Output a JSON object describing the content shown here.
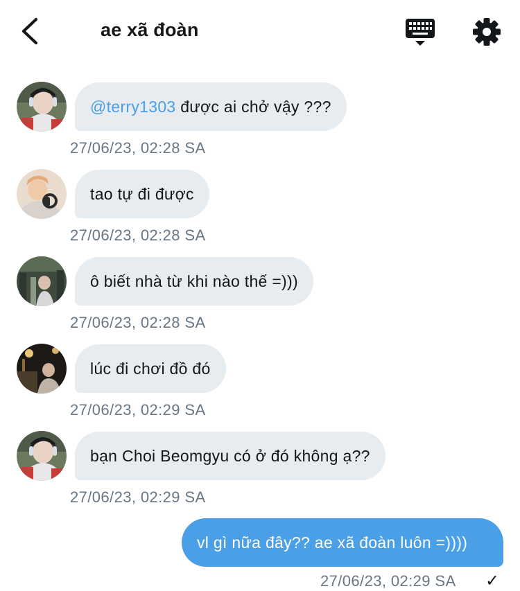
{
  "header": {
    "title": "ae xã đoàn",
    "back_icon": "chevron-left-icon",
    "keyboard_icon": "keyboard-icon",
    "settings_icon": "gear-icon"
  },
  "colors": {
    "incoming_bubble": "#e6ecf0",
    "outgoing_bubble": "#4a9fe6",
    "mention": "#4a9fe6",
    "timestamp": "#687684"
  },
  "messages": [
    {
      "mention": "@terry1303",
      "text": " được ai chở vậy ???",
      "time": "27/06/23, 02:28 SA"
    },
    {
      "text": "tao tự đi được",
      "time": "27/06/23, 02:28 SA"
    },
    {
      "text": "ô biết nhà từ khi nào thế =)))",
      "time": "27/06/23, 02:28 SA"
    },
    {
      "text": "lúc đi chơi đồ đó",
      "time": "27/06/23, 02:29 SA"
    },
    {
      "text": "bạn Choi Beomgyu có ở đó không ạ??",
      "time": "27/06/23, 02:29 SA"
    }
  ],
  "outgoing": {
    "text": "vl gì nữa đây?? ae xã đoàn luôn =))))",
    "time": "27/06/23, 02:29 SA",
    "status": "✓"
  }
}
